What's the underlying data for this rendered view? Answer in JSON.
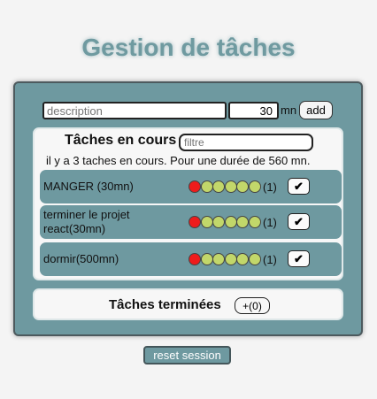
{
  "app": {
    "title": "Gestion de tâches"
  },
  "add_form": {
    "description_placeholder": "description",
    "description_value": "",
    "duration_value": "30",
    "duration_unit": "mn",
    "add_label": "add"
  },
  "current_tasks": {
    "title": "Tâches en cours",
    "filter_placeholder": "filtre",
    "summary": "il y a 3 taches en cours. Pour une durée de 560 mn.",
    "tasks": [
      {
        "label": "MANGER (30mn)",
        "priority": 1,
        "priority_label": "(1)",
        "done_glyph": "✔"
      },
      {
        "label_line1": "terminer le projet",
        "label_line2": "react(30mn)",
        "priority": 1,
        "priority_label": "(1)",
        "done_glyph": "✔"
      },
      {
        "label": "dormir(500mn)",
        "priority": 1,
        "priority_label": "(1)",
        "done_glyph": "✔"
      }
    ],
    "priority_scale": 6
  },
  "finished_tasks": {
    "title": "Tâches terminées",
    "toggle_label": "+(0)"
  },
  "reset": {
    "label": "reset session"
  },
  "colors": {
    "accent": "#6e99a0",
    "priority_selected": "#ee1c1c",
    "priority_unselected": "#c2d76a"
  }
}
